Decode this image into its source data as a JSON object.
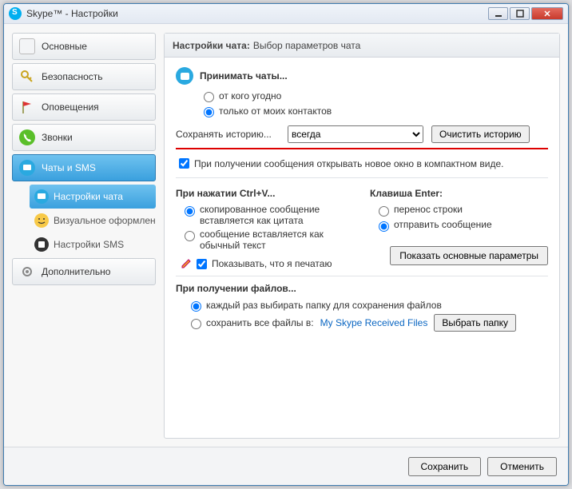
{
  "window": {
    "title": "Skype™ - Настройки"
  },
  "sidebar": {
    "items": [
      {
        "label": "Основные"
      },
      {
        "label": "Безопасность"
      },
      {
        "label": "Оповещения"
      },
      {
        "label": "Звонки"
      },
      {
        "label": "Чаты и SMS"
      }
    ],
    "sub": [
      {
        "label": "Настройки чата"
      },
      {
        "label": "Визуальное оформлен..."
      },
      {
        "label": "Настройки SMS"
      }
    ],
    "extra": {
      "label": "Дополнительно"
    }
  },
  "panel": {
    "title": "Настройки чата:",
    "subtitle": "Выбор параметров чата",
    "accept_chats": {
      "heading": "Принимать чаты...",
      "opt1": "от кого угодно",
      "opt2": "только от моих контактов"
    },
    "history": {
      "label": "Сохранять историю...",
      "selected": "всегда",
      "clear": "Очистить историю"
    },
    "compact": "При получении сообщения открывать новое окно в компактном виде.",
    "ctrlv": {
      "heading": "При нажатии Ctrl+V...",
      "opt1": "скопированное сообщение вставляется как цитата",
      "opt2": "сообщение вставляется как обычный текст"
    },
    "enter": {
      "heading": "Клавиша Enter:",
      "opt1": "перенос строки",
      "opt2": "отправить сообщение"
    },
    "typing": "Показывать, что я печатаю",
    "files": {
      "heading": "При получении файлов...",
      "opt1": "каждый раз выбирать папку для сохранения файлов",
      "opt2": "сохранить все файлы в:",
      "path": "My Skype Received Files",
      "browse": "Выбрать папку"
    },
    "show_basic": "Показать основные параметры"
  },
  "buttons": {
    "save": "Сохранить",
    "cancel": "Отменить"
  }
}
